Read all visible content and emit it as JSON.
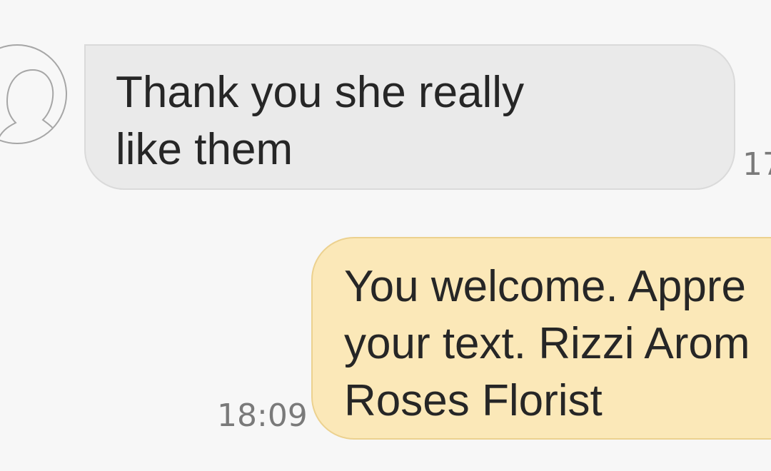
{
  "conversation": {
    "messages": [
      {
        "direction": "incoming",
        "text": "Thank you she really\nlike them",
        "time": "17"
      },
      {
        "direction": "outgoing",
        "text": "You welcome. Appre\nyour text. Rizzi Arom\nRoses Florist",
        "time": "18:09"
      }
    ]
  },
  "icons": {
    "avatar": "contact-avatar-icon"
  },
  "colors": {
    "background": "#f7f7f7",
    "incoming_bubble": "#eaeaea",
    "outgoing_bubble": "#fbe8b8",
    "text": "#262626",
    "timestamp": "#7a7a7a"
  }
}
